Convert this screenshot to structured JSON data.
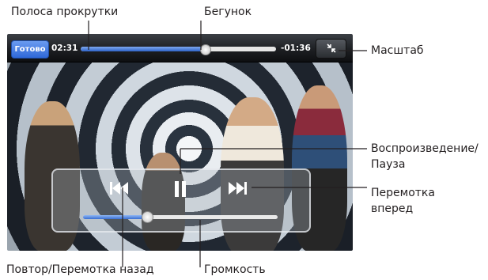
{
  "player": {
    "done_label": "Готово",
    "time_elapsed": "02:31",
    "time_remaining": "-01:36",
    "scrub_progress": 0.64,
    "volume_level": 0.33,
    "accent_color": "#2f68d8"
  },
  "callouts": {
    "scroll_bar": "Полоса прокрутки",
    "playhead": "Бегунок",
    "scale": "Масштаб",
    "play_pause_line1": "Воспроизведение/",
    "play_pause_line2": "Пауза",
    "fast_forward_line1": "Перемотка",
    "fast_forward_line2": "вперед",
    "rewind": "Повтор/Перемотка назад",
    "volume": "Громкость"
  },
  "icons": {
    "previous": "previous-track-icon",
    "pause": "pause-icon",
    "next": "next-track-icon",
    "scale": "scale-icon"
  }
}
